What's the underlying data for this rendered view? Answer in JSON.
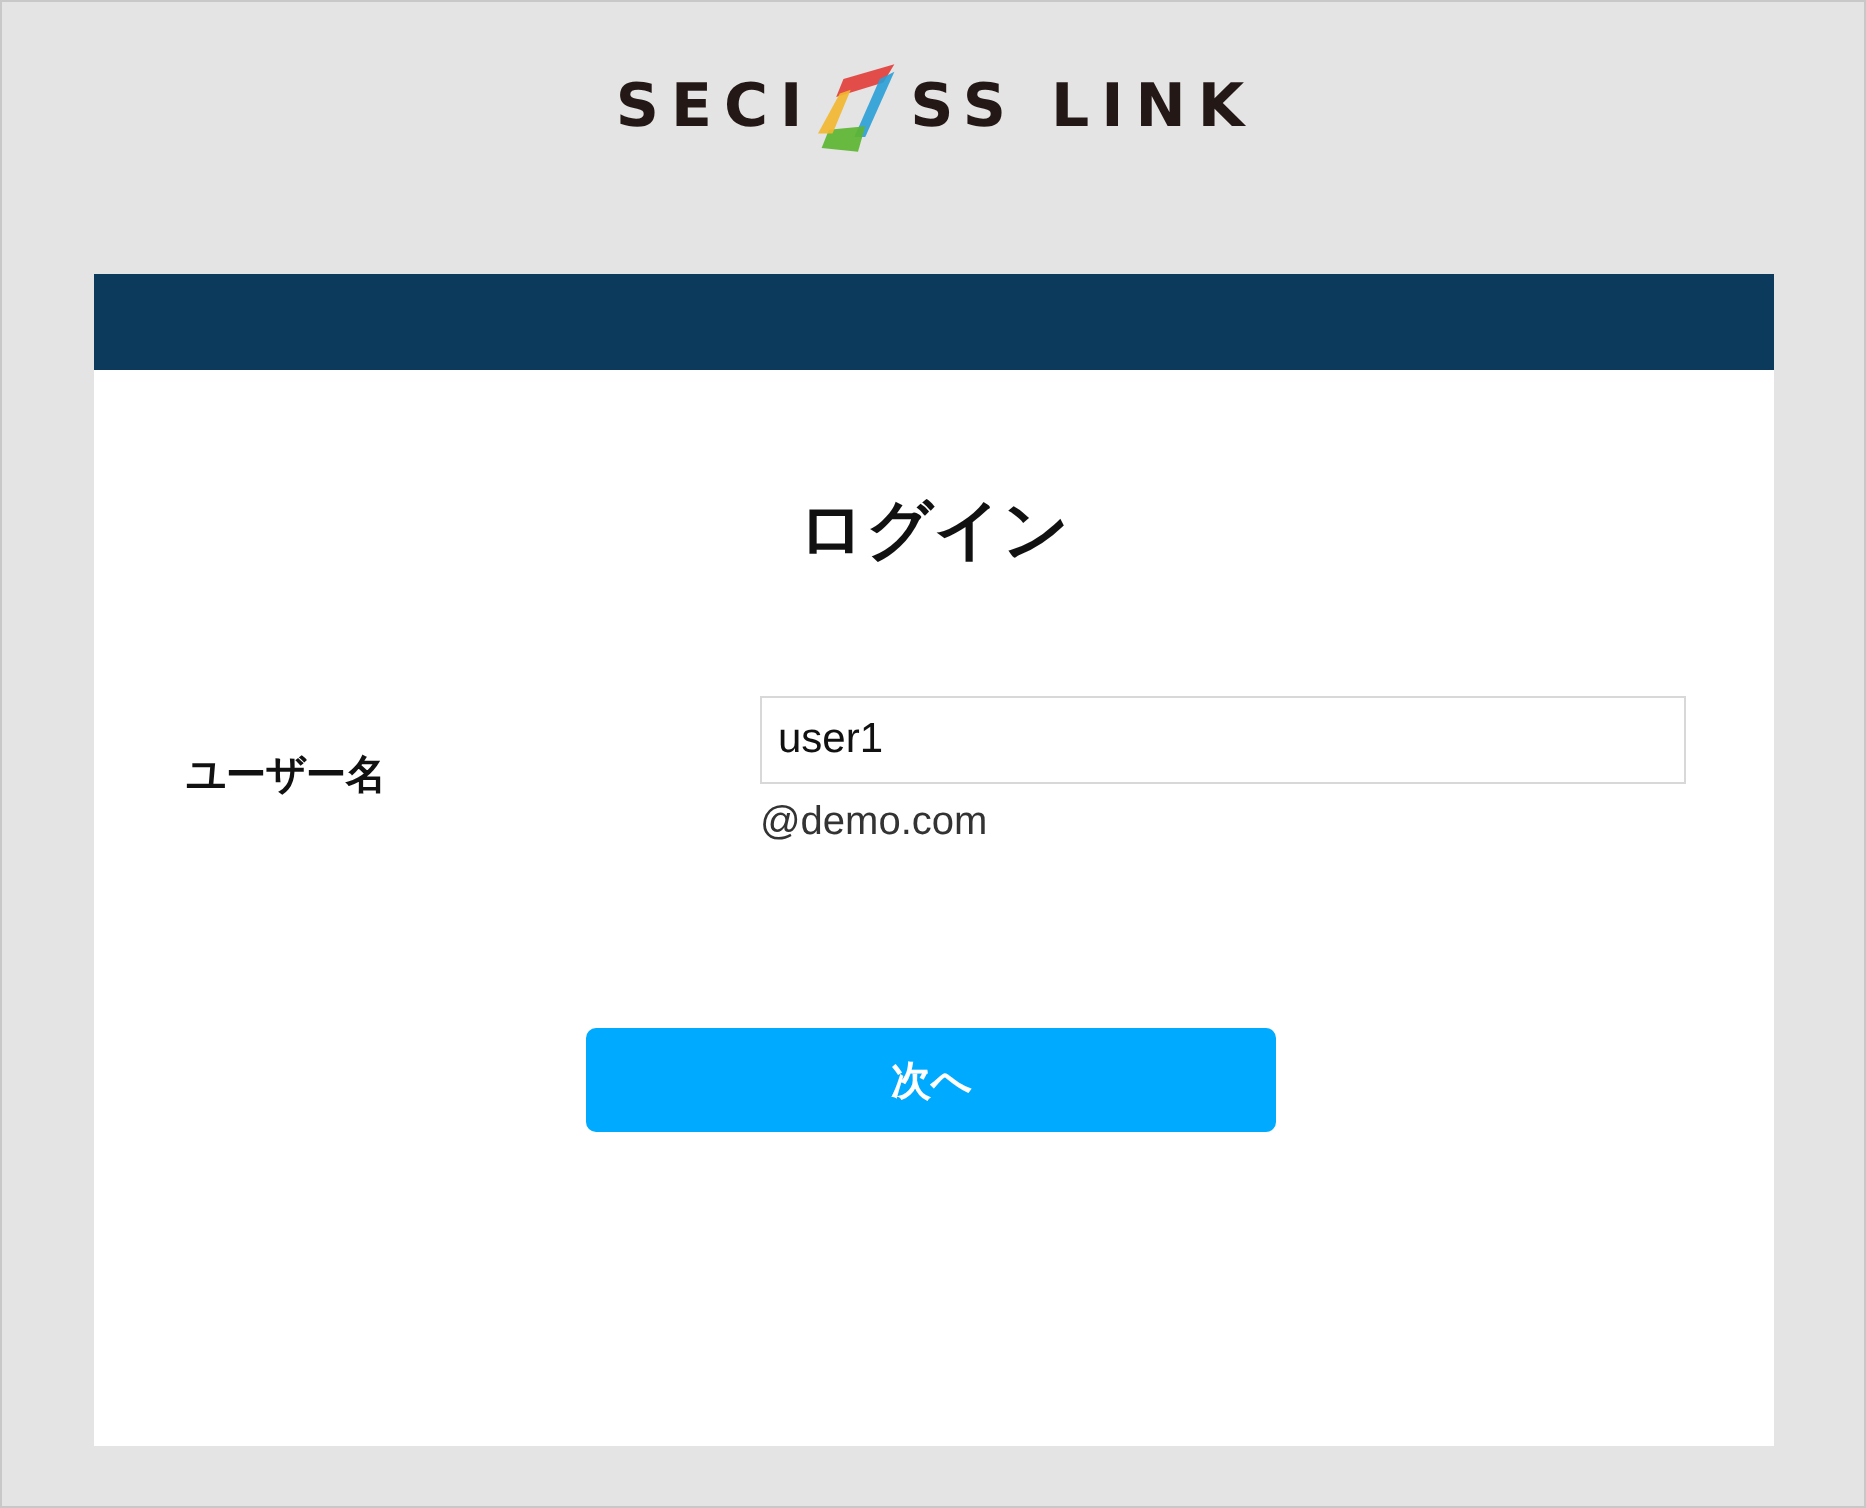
{
  "logo": {
    "parts": [
      "SECI",
      "SS LINK"
    ]
  },
  "form": {
    "title": "ログイン",
    "fields": [
      {
        "label": "ユーザー名",
        "value": "user1",
        "suffix": "@demo.com"
      }
    ],
    "buttons": [
      {
        "label": "次へ"
      }
    ]
  }
}
